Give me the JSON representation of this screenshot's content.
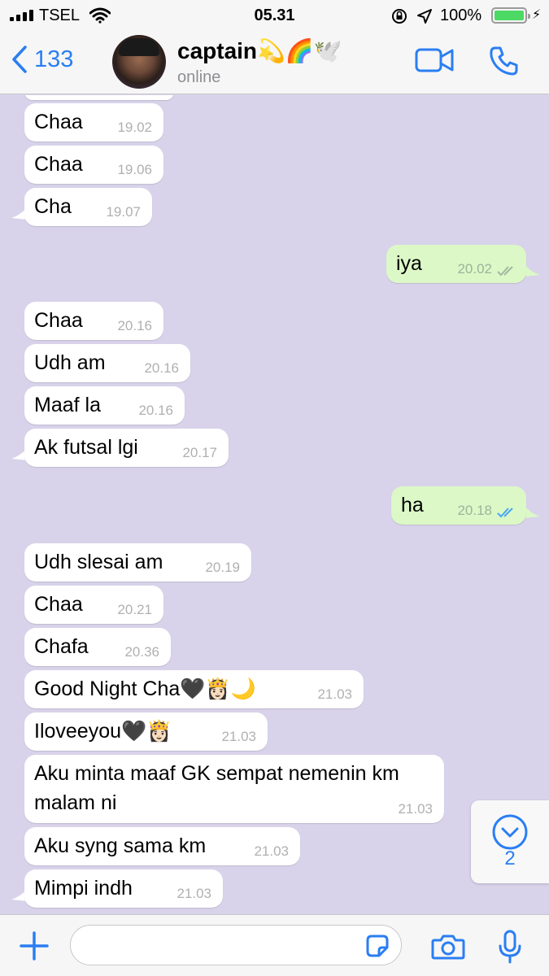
{
  "status": {
    "carrier": "TSEL",
    "time": "05.31",
    "battery": "100%"
  },
  "header": {
    "back_count": "133",
    "contact_name": "captain💫🌈🕊️",
    "presence": "online"
  },
  "messages": [
    {
      "text": "Chaa",
      "time": "19.02",
      "dir": "in"
    },
    {
      "text": "Chaa",
      "time": "19.06",
      "dir": "in"
    },
    {
      "text": "Cha",
      "time": "19.07",
      "dir": "in"
    },
    {
      "text": "iya",
      "time": "20.02",
      "dir": "out",
      "read": false
    },
    {
      "text": "Chaa",
      "time": "20.16",
      "dir": "in"
    },
    {
      "text": "Udh am",
      "time": "20.16",
      "dir": "in"
    },
    {
      "text": "Maaf la",
      "time": "20.16",
      "dir": "in"
    },
    {
      "text": "Ak futsal lgi",
      "time": "20.17",
      "dir": "in"
    },
    {
      "text": "ha",
      "time": "20.18",
      "dir": "out",
      "read": true
    },
    {
      "text": "Udh slesai am",
      "time": "20.19",
      "dir": "in"
    },
    {
      "text": "Chaa",
      "time": "20.21",
      "dir": "in"
    },
    {
      "text": "Chafa",
      "time": "20.36",
      "dir": "in"
    },
    {
      "text": "Good Night Cha🖤👸🏻🌙",
      "time": "21.03",
      "dir": "in"
    },
    {
      "text": "Iloveeyou🖤👸🏻",
      "time": "21.03",
      "dir": "in"
    },
    {
      "text": "Aku minta maaf GK sempat nemenin km",
      "text2": "malam ni",
      "time": "21.03",
      "dir": "in"
    },
    {
      "text": "Aku syng sama km",
      "time": "21.03",
      "dir": "in"
    },
    {
      "text": "Mimpi indh",
      "time": "21.03",
      "dir": "in"
    }
  ],
  "scroll_down": {
    "unread_count": "2"
  },
  "composer": {
    "placeholder": ""
  },
  "colors": {
    "accent": "#2a7ef2",
    "chat_bg": "#d8d3ea",
    "incoming": "#ffffff",
    "outgoing": "#dcf8c7",
    "read_tick": "#4aa6f0",
    "unread_tick": "#a5b8a2"
  }
}
